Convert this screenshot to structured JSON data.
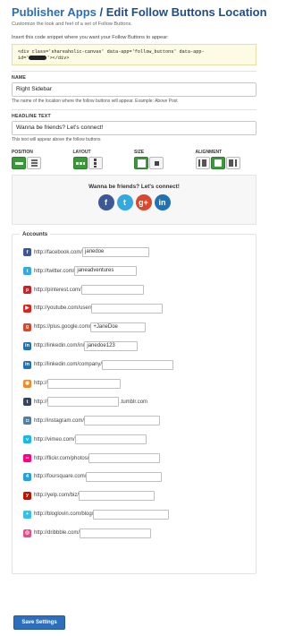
{
  "header": {
    "crumb": "Publisher Apps",
    "separator": " / ",
    "title": "Edit Follow Buttons Location",
    "subtitle": "Customize the look and feel of a set of Follow Buttons."
  },
  "snippet": {
    "instruction": "Insert this code snippet where you want your Follow Buttons to appear:",
    "code_line1": "<div class='shareaholic-canvas' data-app='follow_buttons' data-app-",
    "code_line2_start": "id='",
    "code_line2_end": "'></div>"
  },
  "name_field": {
    "label": "NAME",
    "value": "Right Sidebar",
    "help": "The name of the location where the follow buttons will appear. Example: Above Post"
  },
  "headline_field": {
    "label": "HEADLINE TEXT",
    "value": "Wanna be friends? Let's connect!",
    "help": "This text will appear above the follow buttons"
  },
  "options": {
    "position": "POSITION",
    "layout": "LAYOUT",
    "size": "SIZE",
    "alignment": "ALIGNMENT"
  },
  "preview": {
    "headline": "Wanna be friends? Let's connect!",
    "buttons": [
      {
        "name": "facebook-icon",
        "glyph": "f",
        "color": "#3b5998"
      },
      {
        "name": "twitter-icon",
        "glyph": "t",
        "color": "#33a9e0"
      },
      {
        "name": "google-plus-icon",
        "glyph": "g+",
        "color": "#d6492f"
      },
      {
        "name": "linkedin-icon",
        "glyph": "in",
        "color": "#1f73b4"
      }
    ]
  },
  "accounts": {
    "legend": "Accounts",
    "items": [
      {
        "icon": "facebook-icon",
        "glyph": "f",
        "color": "#3b5998",
        "prefix": "http://facebook.com/",
        "value": "janedoe",
        "suffix": ""
      },
      {
        "icon": "twitter-icon",
        "glyph": "t",
        "color": "#33a9e0",
        "prefix": "http://twitter.com/",
        "value": "janeadventures",
        "suffix": ""
      },
      {
        "icon": "pinterest-icon",
        "glyph": "p",
        "color": "#cb2027",
        "prefix": "http://pinterest.com/",
        "value": "",
        "suffix": ""
      },
      {
        "icon": "youtube-icon",
        "glyph": "▶",
        "color": "#d9251d",
        "prefix": "http://youtube.com/user/",
        "value": "",
        "suffix": ""
      },
      {
        "icon": "google-plus-icon",
        "glyph": "g",
        "color": "#d6492f",
        "prefix": "https://plus.google.com/",
        "value": "+JaneDoe",
        "suffix": ""
      },
      {
        "icon": "linkedin-icon",
        "glyph": "in",
        "color": "#1f73b4",
        "prefix": "http://linkedin.com/in/",
        "value": "janedoe123",
        "suffix": ""
      },
      {
        "icon": "linkedin-company-icon",
        "glyph": "in",
        "color": "#1f73b4",
        "prefix": "http://linkedin.com/company/",
        "value": "",
        "suffix": ""
      },
      {
        "icon": "rss-icon",
        "glyph": "◉",
        "color": "#f08a24",
        "prefix": "http://",
        "value": "",
        "suffix": ""
      },
      {
        "icon": "tumblr-icon",
        "glyph": "t",
        "color": "#35465c",
        "prefix": "http://",
        "value": "",
        "suffix": ".tumblr.com"
      },
      {
        "icon": "instagram-icon",
        "glyph": "◘",
        "color": "#517fa4",
        "prefix": "http://instagram.com/",
        "value": "",
        "suffix": ""
      },
      {
        "icon": "vimeo-icon",
        "glyph": "v",
        "color": "#1ab7ea",
        "prefix": "http://vimeo.com/",
        "value": "",
        "suffix": ""
      },
      {
        "icon": "flickr-icon",
        "glyph": "••",
        "color": "#ff0084",
        "prefix": "http://flickr.com/photos/",
        "value": "",
        "suffix": ""
      },
      {
        "icon": "foursquare-icon",
        "glyph": "4",
        "color": "#2a9fd8",
        "prefix": "http://foursquare.com/",
        "value": "",
        "suffix": ""
      },
      {
        "icon": "yelp-icon",
        "glyph": "y",
        "color": "#c41200",
        "prefix": "http://yelp.com/biz/",
        "value": "",
        "suffix": ""
      },
      {
        "icon": "bloglovin-icon",
        "glyph": "+",
        "color": "#32c2e8",
        "prefix": "http://bloglovin.com/blog/",
        "value": "",
        "suffix": ""
      },
      {
        "icon": "dribbble-icon",
        "glyph": "◎",
        "color": "#ea4c89",
        "prefix": "http://dribbble.com/",
        "value": "",
        "suffix": ""
      }
    ]
  },
  "save_label": "Save Settings"
}
